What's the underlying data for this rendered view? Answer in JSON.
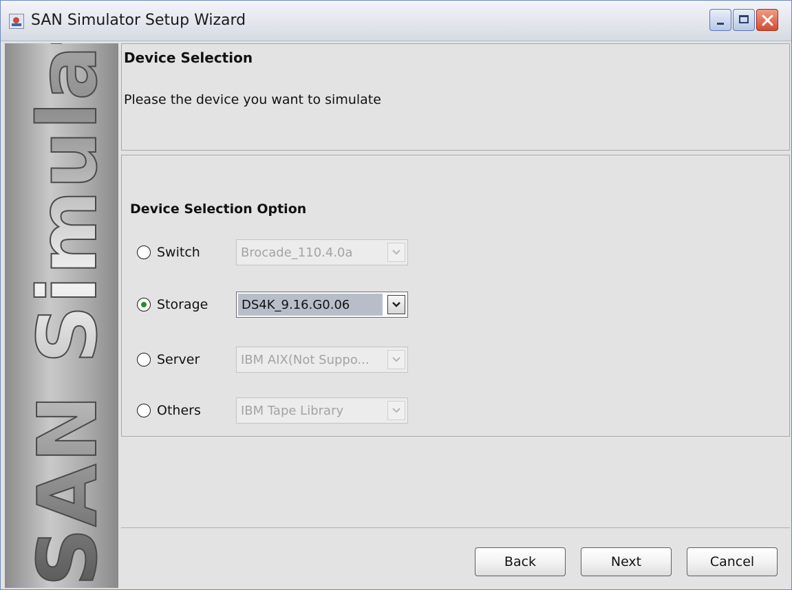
{
  "window": {
    "title": "SAN Simulator Setup Wizard"
  },
  "banner": {
    "text": "SAN Simulator"
  },
  "header": {
    "title": "Device Selection",
    "description": "Please the device you want to simulate"
  },
  "options": {
    "heading": "Device Selection Option",
    "rows": [
      {
        "label": "Switch",
        "selected": false,
        "value": "Brocade_110.4.0a",
        "enabled": false
      },
      {
        "label": "Storage",
        "selected": true,
        "value": "DS4K_9.16.G0.06",
        "enabled": true
      },
      {
        "label": "Server",
        "selected": false,
        "value": "IBM AIX(Not Suppo...",
        "enabled": false
      },
      {
        "label": "Others",
        "selected": false,
        "value": "IBM Tape Library",
        "enabled": false
      }
    ]
  },
  "buttons": {
    "back": "Back",
    "next": "Next",
    "cancel": "Cancel"
  },
  "icons": {
    "app": "java-cup-icon",
    "minimize": "minimize-icon",
    "maximize": "maximize-icon",
    "close": "close-icon",
    "dropdown": "chevron-down-icon"
  },
  "colors": {
    "radio_selected_dot": "#2d8a2d",
    "close_button": "#d64b2f",
    "selected_combo_bg": "#b8bec9"
  }
}
